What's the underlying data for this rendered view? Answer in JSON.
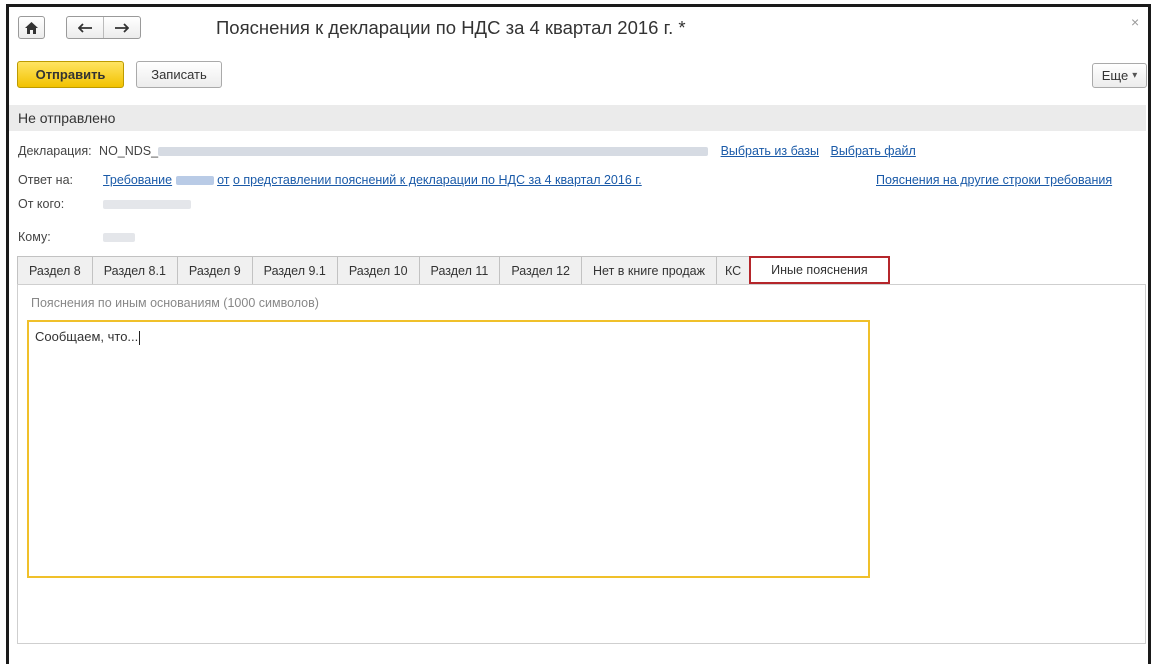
{
  "window": {
    "title": "Пояснения к декларации по НДС за 4 квартал 2016 г. *",
    "close_glyph": "×",
    "home_icon": "home-icon",
    "back_icon": "arrow-left-icon",
    "forward_icon": "arrow-right-icon"
  },
  "toolbar": {
    "send_label": "Отправить",
    "write_label": "Записать",
    "more_label": "Еще",
    "more_arrow": "▾"
  },
  "status": "Не отправлено",
  "declaration": {
    "label": "Декларация:",
    "value_prefix": "NO_NDS_",
    "choose_db": "Выбрать из базы",
    "choose_file": "Выбрать файл"
  },
  "reply": {
    "label": "Ответ на:",
    "link_prefix": "Требование",
    "link_middle": "от",
    "link_suffix": "о представлении пояснений к декларации по НДС за 4 квартал 2016 г.",
    "other_lines": "Пояснения на другие строки требования"
  },
  "from": {
    "label": "От кого:"
  },
  "to": {
    "label": "Кому:"
  },
  "tabs": [
    {
      "label": "Раздел 8"
    },
    {
      "label": "Раздел 8.1"
    },
    {
      "label": "Раздел 9"
    },
    {
      "label": "Раздел 9.1"
    },
    {
      "label": "Раздел 10"
    },
    {
      "label": "Раздел 11"
    },
    {
      "label": "Раздел 12"
    },
    {
      "label": "Нет в книге продаж"
    },
    {
      "label": "КС"
    },
    {
      "label": "Иные пояснения"
    }
  ],
  "active_tab": "Иные пояснения",
  "other_explanations": {
    "caption": "Пояснения по иным основаниям (1000 символов)",
    "text": "Сообщаем, что..."
  },
  "colors": {
    "send_button": "#f2c200",
    "link": "#1a5aa8",
    "active_tab_border": "#b5262b",
    "textarea_border": "#f0c02a"
  }
}
